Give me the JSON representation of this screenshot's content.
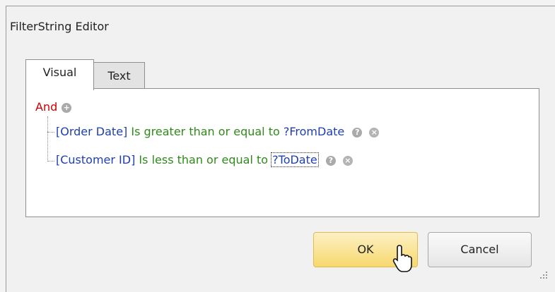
{
  "window": {
    "title": "FilterString Editor"
  },
  "tabs": [
    {
      "label": "Visual",
      "active": true
    },
    {
      "label": "Text",
      "active": false
    }
  ],
  "filter": {
    "group_operator": "And",
    "conditions": [
      {
        "field": "[Order Date]",
        "operator": "Is greater than or equal to",
        "value": "?FromDate"
      },
      {
        "field": "[Customer ID]",
        "operator": "Is less than or equal to",
        "value": "?ToDate"
      }
    ]
  },
  "buttons": {
    "ok_label": "OK",
    "cancel_label": "Cancel"
  },
  "colors": {
    "operator_red": "#cc0000",
    "field_blue": "#1f3fb0",
    "op_green": "#2f8a1b",
    "ok_gold": "#f7d86e"
  },
  "icons": [
    "add-condition-icon",
    "help-icon",
    "remove-condition-icon",
    "mouse-cursor-icon",
    "resize-grip-icon"
  ]
}
